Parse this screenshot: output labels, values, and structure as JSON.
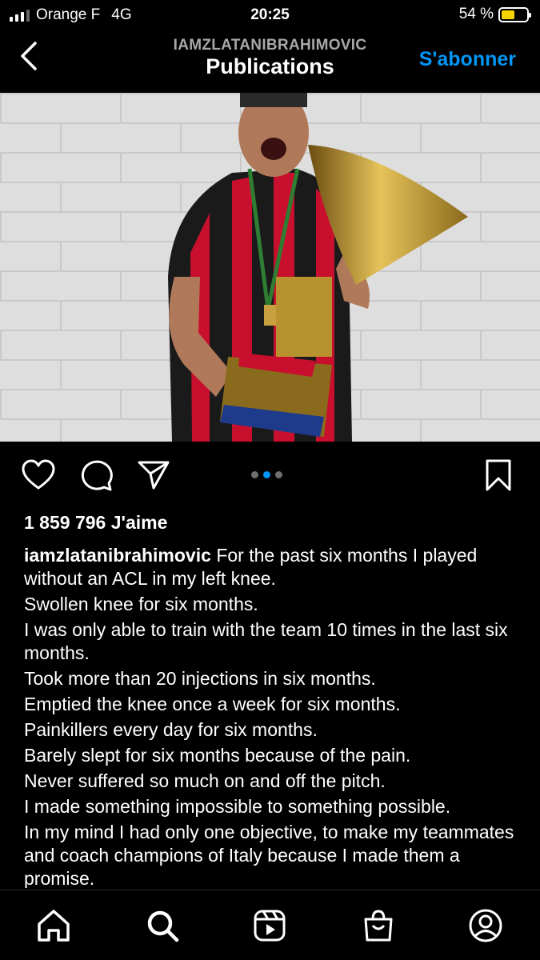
{
  "status_bar": {
    "carrier": "Orange F",
    "network": "4G",
    "time": "20:25",
    "battery_percent": "54 %",
    "battery_level": 0.54
  },
  "header": {
    "username": "IAMZLATANIBRAHIMOVIC",
    "title": "Publications",
    "follow_label": "S'abonner"
  },
  "post": {
    "image": "photo of a football player in a red and black striped jersey holding a large golden trophy",
    "carousel_total": 3,
    "carousel_active": 2,
    "likes": "1 859 796 J'aime",
    "caption_user": "iamzlatanibrahimovic",
    "caption_lines": [
      "For the past six months I played without an ACL in my left knee.",
      "Swollen knee for six months.",
      "I was only able to train with the team 10 times in the last six months.",
      "Took more than 20 injections in six months.",
      "Emptied the knee once a week for six months.",
      "Painkillers every day for six months.",
      "Barely slept for six months because of the pain.",
      "Never suffered so much on and off the pitch.",
      "I made something impossible to something possible.",
      "In my mind I had only one objective, to make my teammates and coach champions of Italy because I made them a promise."
    ]
  },
  "colors": {
    "accent": "#0095f6",
    "background": "#000000",
    "battery": "#f5d300"
  },
  "icons": {
    "back": "chevron-left-icon",
    "like": "heart-icon",
    "comment": "comment-icon",
    "share": "paper-plane-icon",
    "save": "bookmark-icon",
    "home": "home-icon",
    "search": "search-icon",
    "reels": "reels-icon",
    "shop": "shopping-bag-icon",
    "profile": "profile-icon"
  }
}
